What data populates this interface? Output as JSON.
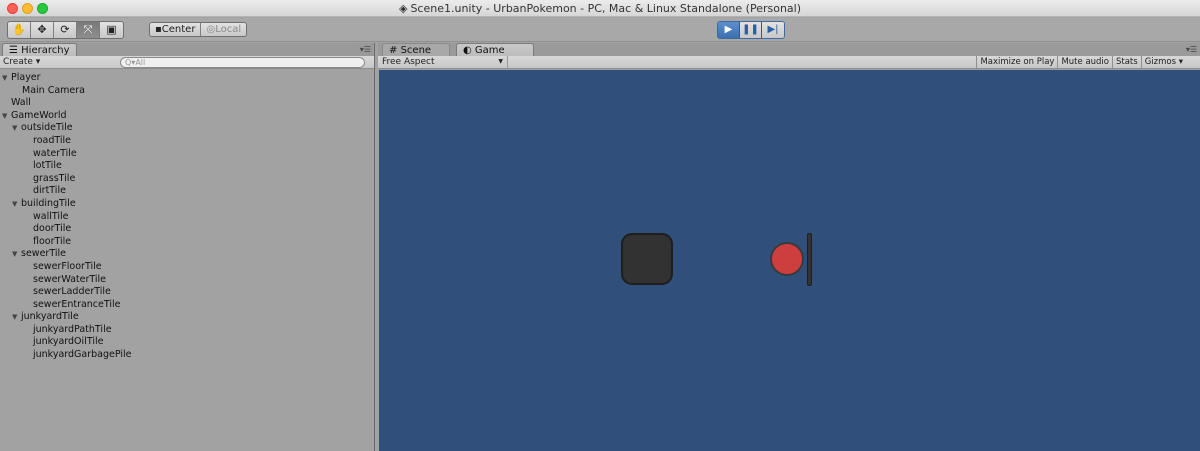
{
  "window": {
    "title": "Scene1.unity - UrbanPokemon - PC, Mac & Linux Standalone (Personal)"
  },
  "toolbar": {
    "tools": [
      {
        "name": "hand-tool",
        "glyph": "✋"
      },
      {
        "name": "move-tool",
        "glyph": "✥"
      },
      {
        "name": "rotate-tool",
        "glyph": "⟳"
      },
      {
        "name": "scale-tool",
        "glyph": "⤧"
      },
      {
        "name": "rect-tool",
        "glyph": "▣"
      }
    ],
    "pivot_center": "Center",
    "pivot_local": "Local",
    "play": {
      "play_glyph": "▶",
      "pause_glyph": "❚❚",
      "step_glyph": "▶|"
    }
  },
  "hierarchy": {
    "tab_label": "Hierarchy",
    "create_label": "Create ▾",
    "search_placeholder": "Q▾All",
    "nodes": [
      {
        "label": "Player",
        "depth": 0,
        "arrow": "▼"
      },
      {
        "label": "Main Camera",
        "depth": 1,
        "arrow": ""
      },
      {
        "label": "Wall",
        "depth": 0,
        "arrow": ""
      },
      {
        "label": "GameWorld",
        "depth": 0,
        "arrow": "▼"
      },
      {
        "label": "outsideTile",
        "depth": 1,
        "arrow": "▼"
      },
      {
        "label": "roadTile",
        "depth": 2,
        "arrow": ""
      },
      {
        "label": "waterTile",
        "depth": 2,
        "arrow": ""
      },
      {
        "label": "lotTile",
        "depth": 2,
        "arrow": ""
      },
      {
        "label": "grassTile",
        "depth": 2,
        "arrow": ""
      },
      {
        "label": "dirtTile",
        "depth": 2,
        "arrow": ""
      },
      {
        "label": "buildingTile",
        "depth": 1,
        "arrow": "▼"
      },
      {
        "label": "wallTile",
        "depth": 2,
        "arrow": ""
      },
      {
        "label": "doorTile",
        "depth": 2,
        "arrow": ""
      },
      {
        "label": "floorTile",
        "depth": 2,
        "arrow": ""
      },
      {
        "label": "sewerTile",
        "depth": 1,
        "arrow": "▼"
      },
      {
        "label": "sewerFloorTile",
        "depth": 2,
        "arrow": ""
      },
      {
        "label": "sewerWaterTile",
        "depth": 2,
        "arrow": ""
      },
      {
        "label": "sewerLadderTile",
        "depth": 2,
        "arrow": ""
      },
      {
        "label": "sewerEntranceTile",
        "depth": 2,
        "arrow": ""
      },
      {
        "label": "junkyardTile",
        "depth": 1,
        "arrow": "▼"
      },
      {
        "label": "junkyardPathTile",
        "depth": 2,
        "arrow": ""
      },
      {
        "label": "junkyardOilTile",
        "depth": 2,
        "arrow": ""
      },
      {
        "label": "junkyardGarbagePile",
        "depth": 2,
        "arrow": ""
      }
    ]
  },
  "game": {
    "scene_tab": "Scene",
    "game_tab": "Game",
    "aspect": "Free Aspect",
    "options": [
      "Maximize on Play",
      "Mute audio",
      "Stats",
      "Gizmos ▾"
    ],
    "colors": {
      "background": "#30507b",
      "block": "#323232",
      "ball": "#cc3f3e",
      "paddle": "#333333"
    }
  }
}
